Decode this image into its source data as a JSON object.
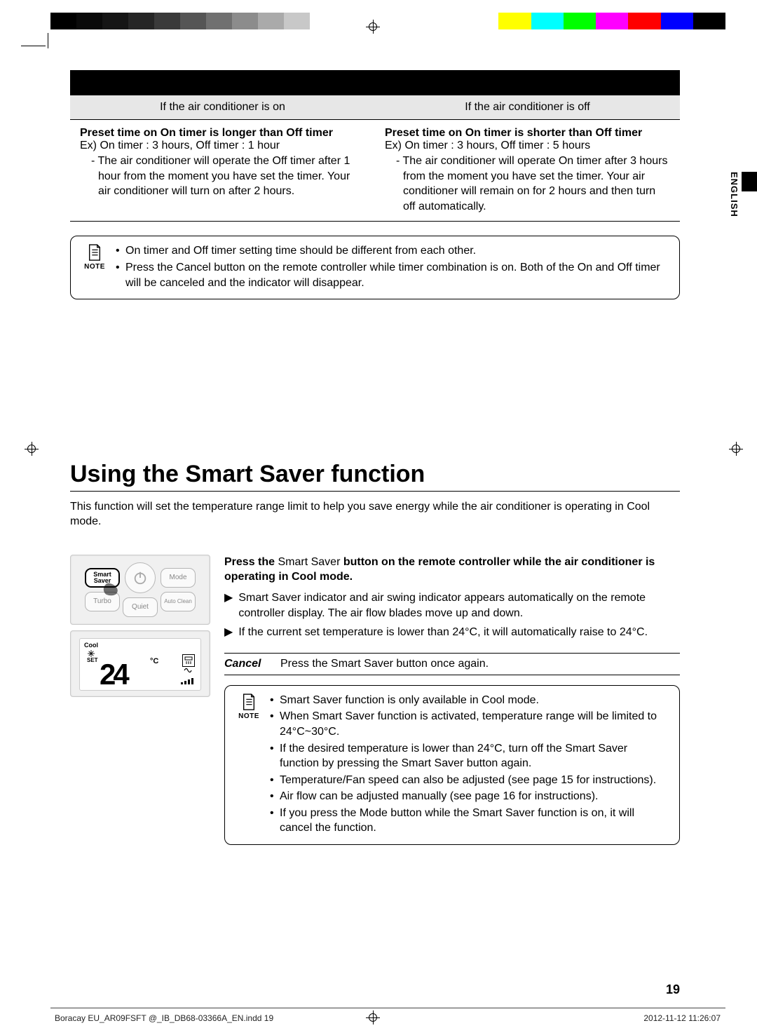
{
  "page_number": "19",
  "language_tab": "ENGLISH",
  "section_title": "Using the Smart Saver function",
  "section_intro": "This function will set the temperature range limit to help you save energy while the air conditioner is operating in Cool mode.",
  "top_table": {
    "col_on_header": "If the air conditioner is on",
    "col_off_header": "If the air conditioner is off",
    "left": {
      "title": "Preset time on On timer is longer than Off timer",
      "example": "Ex) On timer : 3 hours, Off timer : 1 hour",
      "body": "- The air conditioner will operate the Off timer after 1 hour from the moment you have set the timer. Your air conditioner will turn on after 2 hours."
    },
    "right": {
      "title": "Preset time on On timer is shorter than Off timer",
      "example": "Ex) On timer : 3 hours, Off timer : 5 hours",
      "body": "- The air conditioner will operate On timer after 3 hours from the moment you have set the timer. Your air conditioner will remain on for 2 hours and then turn off automatically."
    }
  },
  "note_top": {
    "label": "NOTE",
    "items": [
      "On timer and Off timer setting time should be different from each other.",
      "Press the Cancel button on the remote controller while timer combination is on. Both of the On and Off timer will be canceled and the indicator will disappear."
    ]
  },
  "remote": {
    "smart_saver": "Smart Saver",
    "mode": "Mode",
    "turbo": "Turbo",
    "quiet": "Quiet",
    "auto_clean": "Auto Clean",
    "lcd_mode": "Cool",
    "lcd_set": "SET",
    "lcd_temp": "24",
    "lcd_unit": "°C"
  },
  "instructions": {
    "heading_pre": "Press the ",
    "heading_btn": "Smart Saver",
    "heading_post": " button on the remote controller while the air conditioner is operating in Cool mode.",
    "bullets": [
      "Smart Saver indicator and air swing indicator appears automatically on the remote controller display. The air flow blades move up and down.",
      "If the current set temperature is lower than 24°C, it will automatically raise to 24°C."
    ]
  },
  "cancel": {
    "label": "Cancel",
    "text": "Press the Smart Saver button once again."
  },
  "note_bottom": {
    "label": "NOTE",
    "items": [
      "Smart Saver function is only available in Cool mode.",
      "When Smart Saver function is activated, temperature range will be limited to 24°C~30°C.",
      "If the desired temperature is lower than 24°C, turn off the Smart Saver function by pressing the Smart Saver button again.",
      "Temperature/Fan speed can also be adjusted (see page 15 for instructions).",
      "Air flow can be adjusted manually (see page 16 for instructions).",
      "If you press the Mode button while the Smart Saver function is on, it will cancel the function."
    ]
  },
  "footer": {
    "file": "Boracay EU_AR09FSFT @_IB_DB68-03366A_EN.indd   19",
    "timestamp": "2012-11-12   11:26:07"
  }
}
